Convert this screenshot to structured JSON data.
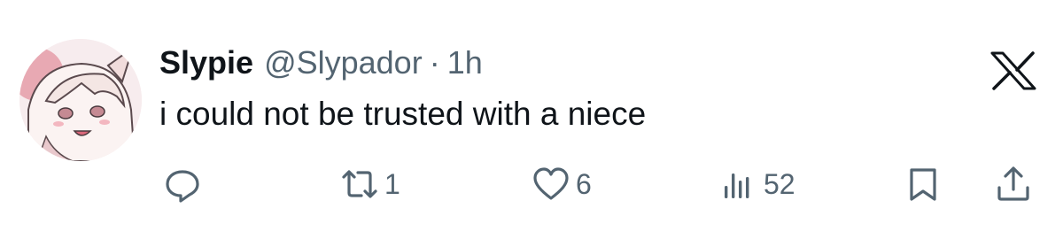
{
  "tweet": {
    "display_name": "Slypie",
    "handle": "@Slypador",
    "separator": "·",
    "time": "1h",
    "text": "i could not be trusted with a niece"
  },
  "actions": {
    "reply": {
      "icon": "reply-icon"
    },
    "retweet": {
      "icon": "retweet-icon",
      "count": "1"
    },
    "like": {
      "icon": "heart-icon",
      "count": "6"
    },
    "views": {
      "icon": "views-icon",
      "count": "52"
    },
    "bookmark": {
      "icon": "bookmark-icon"
    },
    "share": {
      "icon": "share-icon"
    }
  },
  "colors": {
    "text": "#0f1419",
    "secondary": "#536471",
    "background": "#ffffff",
    "avatar_bg": "#f6e9ea"
  }
}
